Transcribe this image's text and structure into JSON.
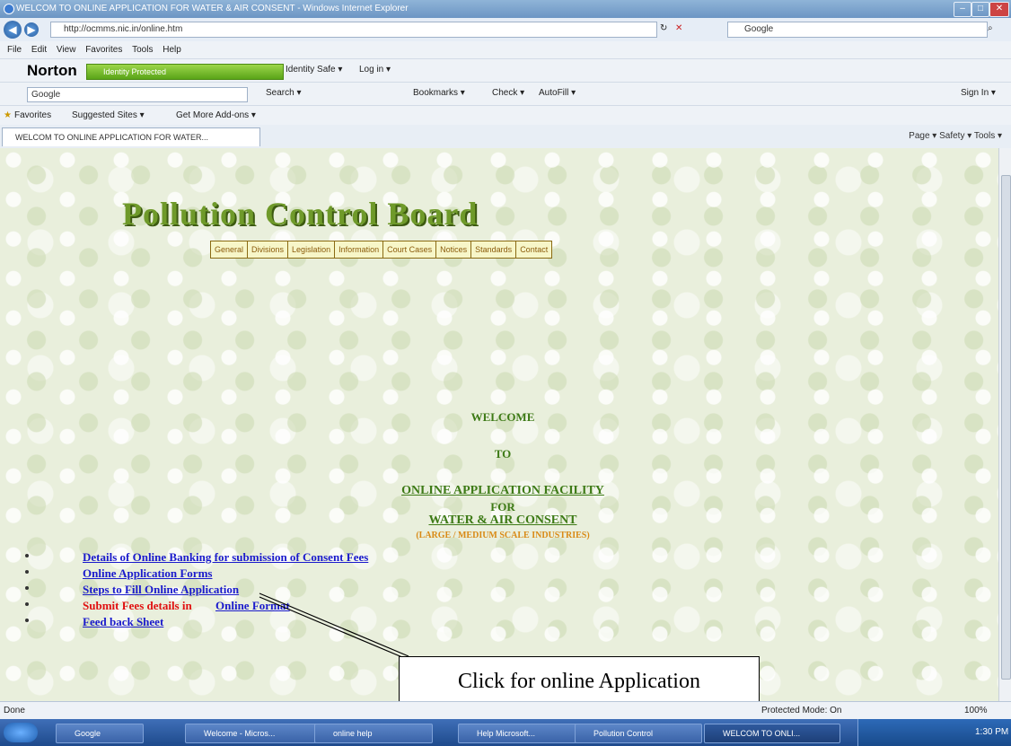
{
  "window": {
    "title": "WELCOM TO ONLINE APPLICATION FOR WATER & AIR CONSENT - Windows Internet Explorer",
    "address": "http://ocmms.nic.in/online.htm",
    "search_placeholder": "Google"
  },
  "menu": [
    "File",
    "Edit",
    "View",
    "Favorites",
    "Tools",
    "Help"
  ],
  "norton": {
    "logo": "Norton",
    "status": "Identity Protected",
    "items": [
      "Identity Safe ▾",
      "Log in ▾"
    ]
  },
  "google_toolbar": {
    "label": "Google",
    "items": [
      "Search ▾",
      "Bookmarks ▾",
      "Check ▾",
      "AutoFill ▾"
    ],
    "signin": "Sign In ▾"
  },
  "favorites_bar": {
    "favorites": "Favorites",
    "suggested": "Suggested Sites ▾",
    "addons": "Get More Add-ons ▾"
  },
  "tab": {
    "label": "WELCOM TO ONLINE APPLICATION FOR WATER..."
  },
  "command_bar": "Page ▾   Safety ▾   Tools ▾",
  "page": {
    "board_title": "Pollution Control Board",
    "nav": [
      "General",
      "Divisions",
      "Legislation",
      "Information",
      "Court Cases",
      "Notices",
      "Standards",
      "Contact"
    ],
    "welcome": {
      "line1": "WELCOME",
      "line2": "TO",
      "line3": "ONLINE APPLICATION FACILITY",
      "line4": "FOR",
      "line5": "WATER & AIR CONSENT",
      "line6": "(LARGE / MEDIUM SCALE INDUSTRIES)"
    },
    "links": [
      "Details of Online Banking for submission of Consent Fees",
      "Online Application Forms",
      "Steps to Fill Online Application",
      "Submit Fees details in",
      "Online Format",
      "Feed back Sheet"
    ],
    "callout": "Click for online Application"
  },
  "status_bar": {
    "left": "Done",
    "mode": "Protected Mode: On",
    "zoom": "100%"
  },
  "taskbar": {
    "items": [
      "Google",
      "Welcome - Micros...",
      "online help",
      "Help Microsoft...",
      "Pollution Control",
      "WELCOM TO ONLI..."
    ],
    "clock": "1:30 PM"
  },
  "colors": {
    "link": "#1a1acc",
    "heading_green": "#3d7a16",
    "alert_red": "#e01010",
    "orange": "#d98a16"
  }
}
